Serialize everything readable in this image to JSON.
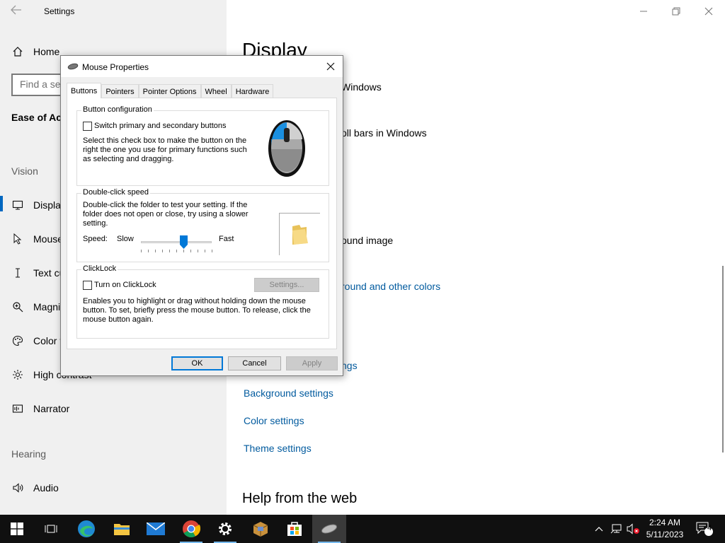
{
  "settings": {
    "app_title": "Settings",
    "sidebar": {
      "home": "Home",
      "search_placeholder": "Find a setting",
      "category": "Ease of Access",
      "section_vision": "Vision",
      "items_vision": [
        {
          "label": "Display",
          "icon": "monitor-icon"
        },
        {
          "label": "Mouse pointer",
          "icon": "mouse-pointer-icon"
        },
        {
          "label": "Text cursor",
          "icon": "text-cursor-icon"
        },
        {
          "label": "Magnifier",
          "icon": "magnifier-icon"
        },
        {
          "label": "Color filters",
          "icon": "color-filters-icon"
        },
        {
          "label": "High contrast",
          "icon": "high-contrast-icon"
        },
        {
          "label": "Narrator",
          "icon": "narrator-icon"
        }
      ],
      "section_hearing": "Hearing",
      "items_hearing": [
        {
          "label": "Audio",
          "icon": "audio-icon"
        }
      ]
    },
    "main": {
      "title": "Display",
      "line1": "Windows",
      "line2": "oll bars in Windows",
      "line3": "ound image",
      "link_partial1": "round and other colors",
      "link_partial2": "ngs",
      "links": [
        "Background settings",
        "Color settings",
        "Theme settings"
      ],
      "help_title": "Help from the web"
    }
  },
  "dialog": {
    "title": "Mouse Properties",
    "tabs": [
      "Buttons",
      "Pointers",
      "Pointer Options",
      "Wheel",
      "Hardware"
    ],
    "active_tab": "Buttons",
    "button_config": {
      "group_title": "Button configuration",
      "checkbox_label": "Switch primary and secondary buttons",
      "checked": false,
      "description": [
        "Select this check box to make the button on the",
        "right the one you use for primary functions such",
        "as selecting and dragging."
      ]
    },
    "double_click": {
      "group_title": "Double-click speed",
      "description": [
        "Double-click the folder to test your setting. If the",
        "folder does not open or close, try using a slower",
        "setting."
      ],
      "speed_label": "Speed:",
      "slow_label": "Slow",
      "fast_label": "Fast",
      "speed_value": 0.6
    },
    "clicklock": {
      "group_title": "ClickLock",
      "checkbox_label": "Turn on ClickLock",
      "checked": false,
      "settings_button": "Settings...",
      "description": [
        "Enables you to highlight or drag without holding down the mouse",
        "button. To set, briefly press the mouse button. To release, click the",
        "mouse button again."
      ]
    },
    "buttons": {
      "ok": "OK",
      "cancel": "Cancel",
      "apply": "Apply"
    }
  },
  "taskbar": {
    "time": "2:24 AM",
    "date": "5/11/2023",
    "notification_count": "4",
    "colors": {
      "accent": "#0078d7",
      "link": "#005a9e",
      "taskbar": "#101010"
    }
  }
}
